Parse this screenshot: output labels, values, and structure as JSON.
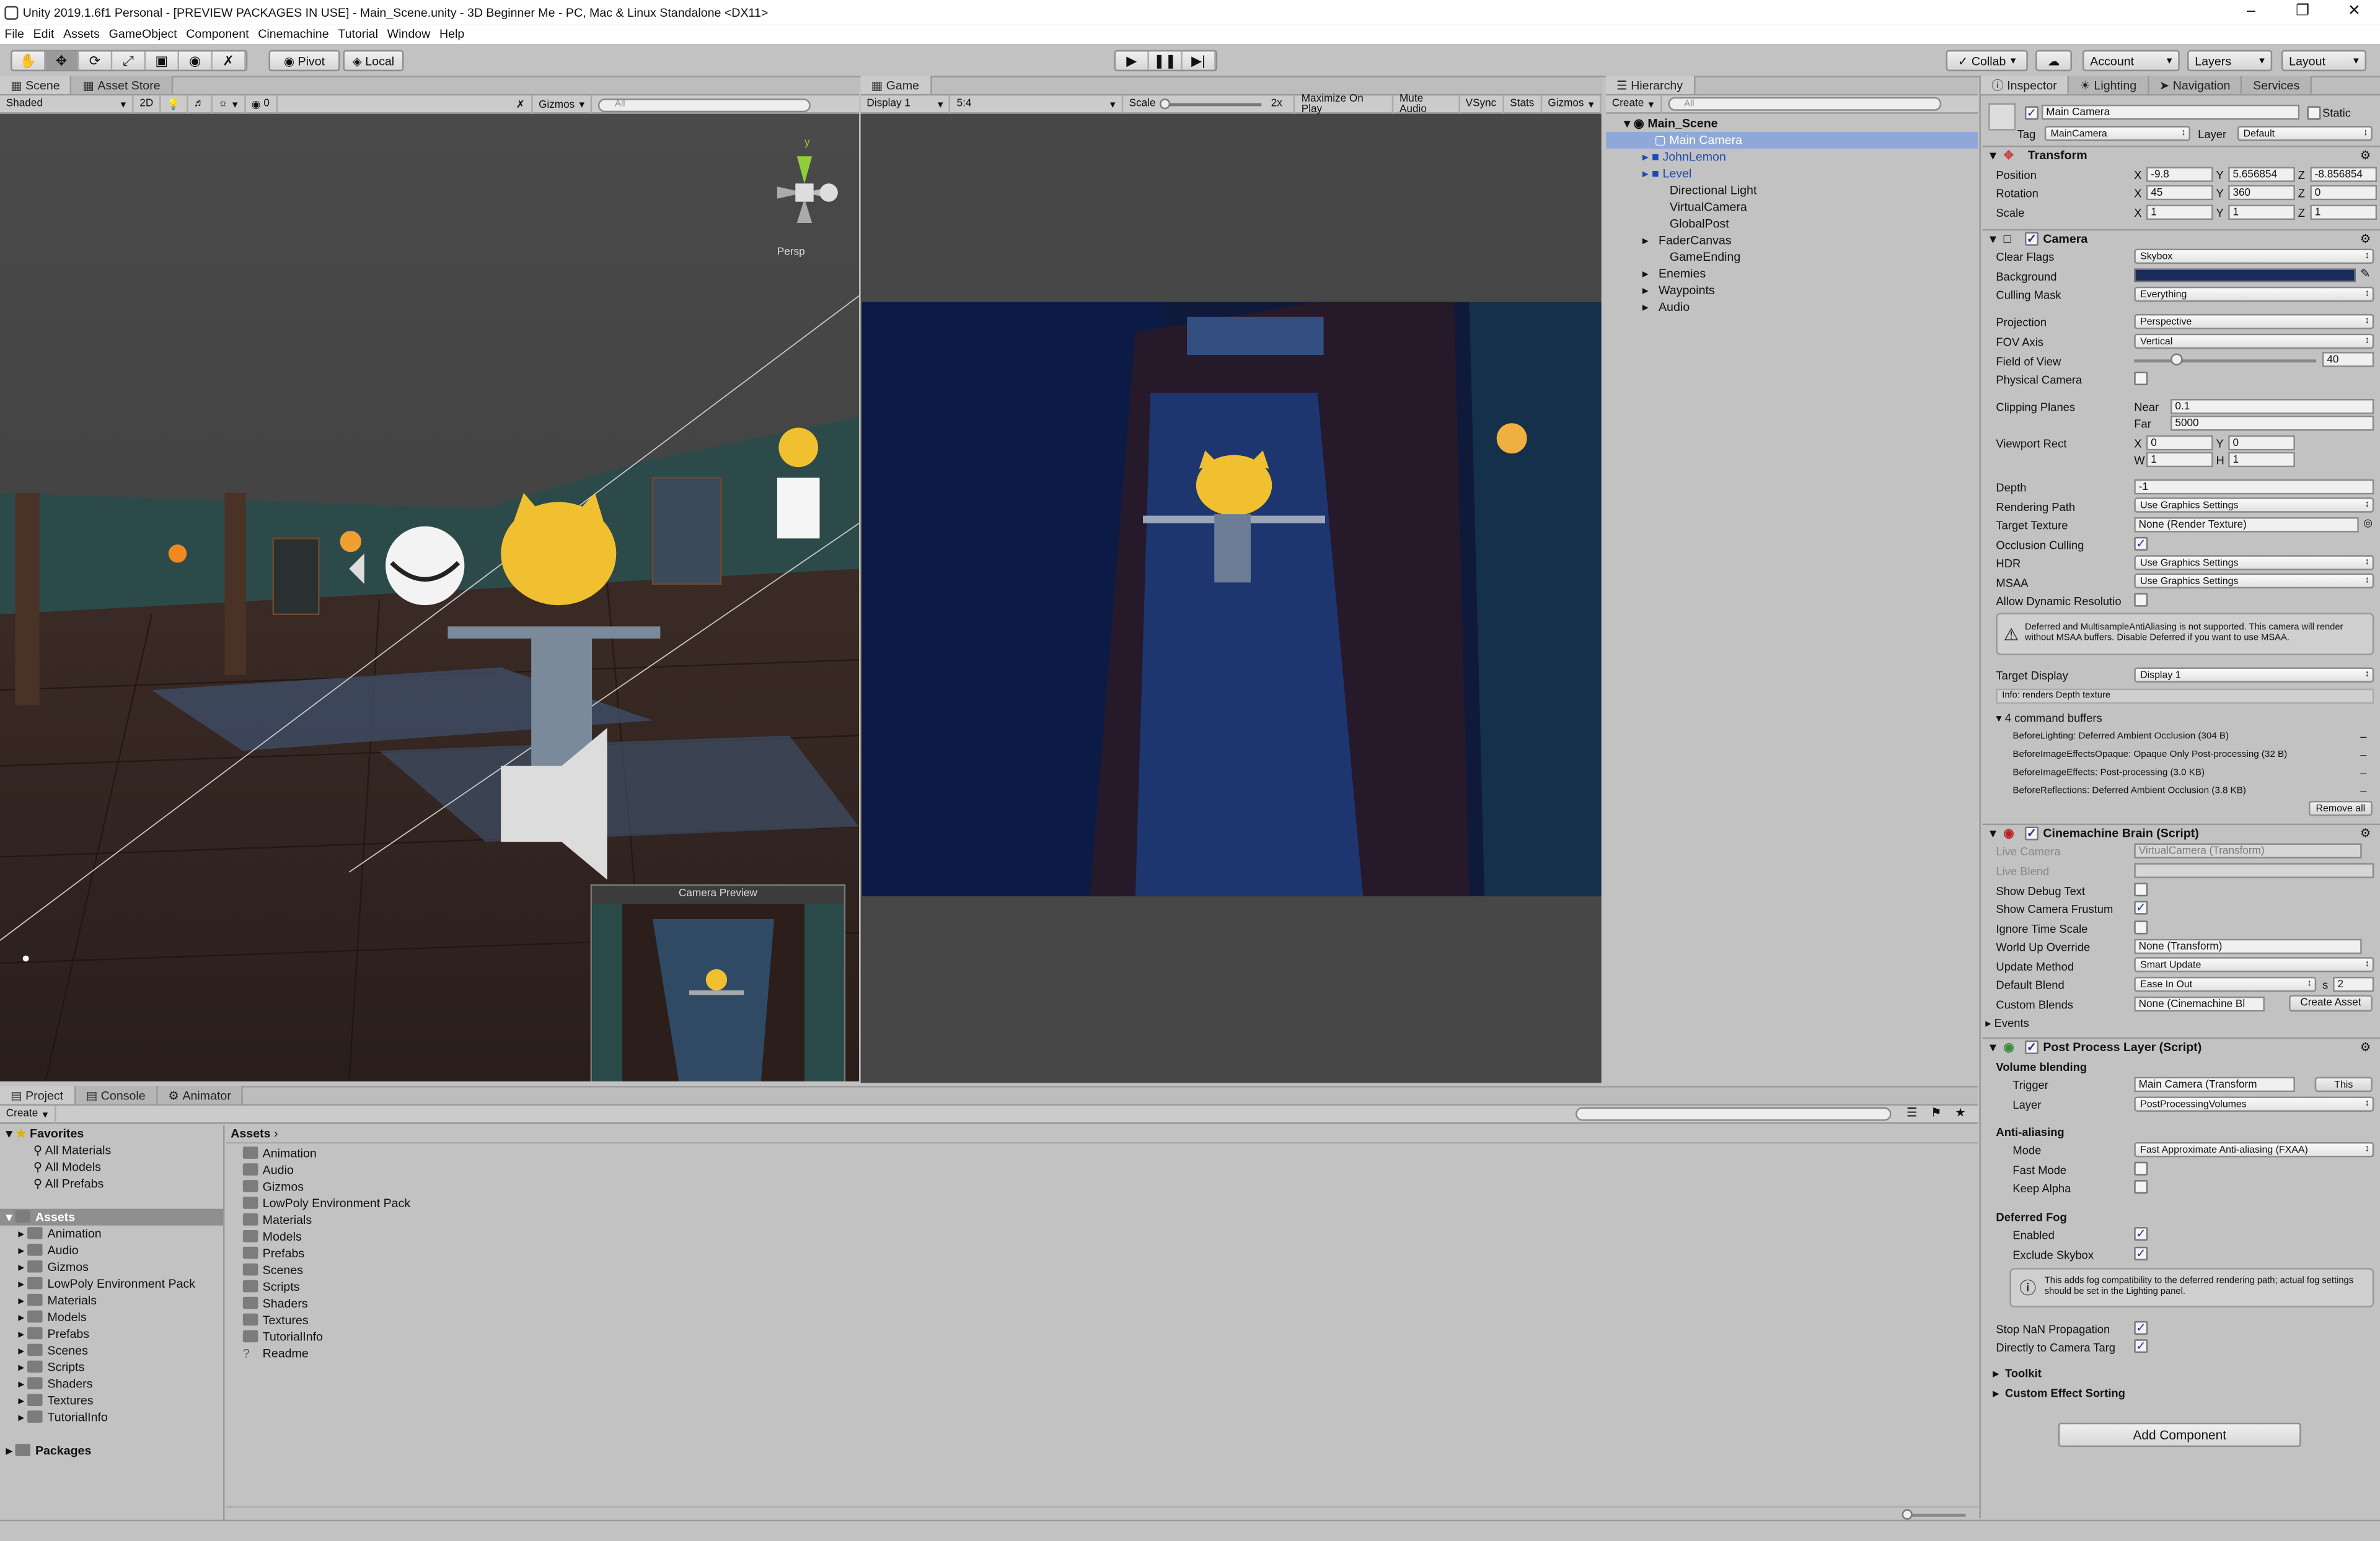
{
  "window": {
    "title": "Unity 2019.1.6f1 Personal - [PREVIEW PACKAGES IN USE] - Main_Scene.unity - 3D Beginner Me - PC, Mac & Linux Standalone <DX11>"
  },
  "menu": [
    "File",
    "Edit",
    "Assets",
    "GameObject",
    "Component",
    "Cinemachine",
    "Tutorial",
    "Window",
    "Help"
  ],
  "toolbar": {
    "pivot": "Pivot",
    "local": "Local",
    "collab": "Collab",
    "account": "Account",
    "layers": "Layers",
    "layout": "Layout"
  },
  "scene": {
    "tab": "Scene",
    "tab2": "Asset Store",
    "shading": "Shaded",
    "mode2d": "2D",
    "gizmos": "Gizmos",
    "search": "All",
    "lightcount": "0",
    "persp": "Persp",
    "preview_title": "Camera Preview",
    "axis_y": "y"
  },
  "game": {
    "tab": "Game",
    "display": "Display 1",
    "aspect": "5:4",
    "scale_label": "Scale",
    "scale_val": "2x",
    "maximize": "Maximize On Play",
    "mute": "Mute Audio",
    "vsync": "VSync",
    "stats": "Stats",
    "gizmos": "Gizmos"
  },
  "hierarchy": {
    "tab": "Hierarchy",
    "create": "Create",
    "search": "All",
    "scene": "Main_Scene",
    "items": [
      "Main Camera",
      "JohnLemon",
      "Level",
      "Directional Light",
      "VirtualCamera",
      "GlobalPost",
      "FaderCanvas",
      "GameEnding",
      "Enemies",
      "Waypoints",
      "Audio"
    ]
  },
  "inspector": {
    "tabs": [
      "Inspector",
      "Lighting",
      "Navigation",
      "Services"
    ],
    "name": "Main Camera",
    "static": "Static",
    "tag_label": "Tag",
    "tag": "MainCamera",
    "layer_label": "Layer",
    "layer": "Default",
    "transform": {
      "title": "Transform",
      "pos_label": "Position",
      "rot_label": "Rotation",
      "scale_label": "Scale",
      "px": "-9.8",
      "py": "5.656854",
      "pz": "-8.856854",
      "rx": "45",
      "ry": "360",
      "rz": "0",
      "sx": "1",
      "sy": "1",
      "sz": "1",
      "X": "X",
      "Y": "Y",
      "Z": "Z"
    },
    "camera": {
      "title": "Camera",
      "clear_flags": "Clear Flags",
      "clear_flags_v": "Skybox",
      "background": "Background",
      "culling": "Culling Mask",
      "culling_v": "Everything",
      "projection": "Projection",
      "projection_v": "Perspective",
      "fov_axis": "FOV Axis",
      "fov_axis_v": "Vertical",
      "fov": "Field of View",
      "fov_v": "40",
      "physical": "Physical Camera",
      "clipping": "Clipping Planes",
      "near": "Near",
      "near_v": "0.1",
      "far": "Far",
      "far_v": "5000",
      "viewport": "Viewport Rect",
      "vx": "0",
      "vy": "0",
      "vw": "1",
      "vh": "1",
      "W": "W",
      "H": "H",
      "depth": "Depth",
      "depth_v": "-1",
      "rpath": "Rendering Path",
      "rpath_v": "Use Graphics Settings",
      "target_tex": "Target Texture",
      "target_tex_v": "None (Render Texture)",
      "occlusion": "Occlusion Culling",
      "hdr": "HDR",
      "hdr_v": "Use Graphics Settings",
      "msaa": "MSAA",
      "msaa_v": "Use Graphics Settings",
      "dyn": "Allow Dynamic Resolutio",
      "warning": "Deferred and MultisampleAntiAliasing is not supported. This camera will render without MSAA buffers. Disable Deferred if you want to use MSAA.",
      "target_display": "Target Display",
      "target_display_v": "Display 1",
      "info": "Info: renders Depth texture",
      "cmd_header": "4 command buffers",
      "cmds": [
        "BeforeLighting: Deferred Ambient Occlusion (304 B)",
        "BeforeImageEffectsOpaque: Opaque Only Post-processing (32 B)",
        "BeforeImageEffects: Post-processing (3.0 KB)",
        "BeforeReflections: Deferred Ambient Occlusion (3.8 KB)"
      ],
      "remove_all": "Remove all"
    },
    "brain": {
      "title": "Cinemachine Brain (Script)",
      "live_camera": "Live Camera",
      "live_camera_v": "VirtualCamera (Transform)",
      "live_blend": "Live Blend",
      "debug": "Show Debug Text",
      "frustum": "Show Camera Frustum",
      "ignore": "Ignore Time Scale",
      "world_up": "World Up Override",
      "world_up_v": "None (Transform)",
      "update": "Update Method",
      "update_v": "Smart Update",
      "default_blend": "Default Blend",
      "default_blend_v": "Ease In Out",
      "s": "s",
      "blend_time": "2",
      "custom": "Custom Blends",
      "custom_v": "None (Cinemachine Bl",
      "create_asset": "Create Asset",
      "events": "Events"
    },
    "ppl": {
      "title": "Post Process Layer (Script)",
      "volume": "Volume blending",
      "trigger": "Trigger",
      "trigger_v": "Main Camera (Transform",
      "this": "This",
      "layer": "Layer",
      "layer_v": "PostProcessingVolumes",
      "aa": "Anti-aliasing",
      "mode": "Mode",
      "mode_v": "Fast Approximate Anti-aliasing (FXAA)",
      "fast": "Fast Mode",
      "keep": "Keep Alpha",
      "fog": "Deferred Fog",
      "enabled": "Enabled",
      "exclude": "Exclude Skybox",
      "fog_info": "This adds fog compatibility to the deferred rendering path; actual fog settings should be set in the Lighting panel.",
      "nan": "Stop NaN Propagation",
      "direct": "Directly to Camera Targ",
      "toolkit": "Toolkit",
      "custom_sort": "Custom Effect Sorting"
    },
    "add_component": "Add Component"
  },
  "project": {
    "tabs": [
      "Project",
      "Console",
      "Animator"
    ],
    "create": "Create",
    "favorites": "Favorites",
    "fav_items": [
      "All Materials",
      "All Models",
      "All Prefabs"
    ],
    "assets": "Assets",
    "asset_items": [
      "Animation",
      "Audio",
      "Gizmos",
      "LowPoly Environment Pack",
      "Materials",
      "Models",
      "Prefabs",
      "Scenes",
      "Scripts",
      "Shaders",
      "Textures",
      "TutorialInfo"
    ],
    "packages": "Packages",
    "breadcrumb": "Assets",
    "grid_items": [
      "Animation",
      "Audio",
      "Gizmos",
      "LowPoly Environment Pack",
      "Materials",
      "Models",
      "Prefabs",
      "Scenes",
      "Scripts",
      "Shaders",
      "Textures",
      "TutorialInfo",
      "Readme"
    ]
  }
}
